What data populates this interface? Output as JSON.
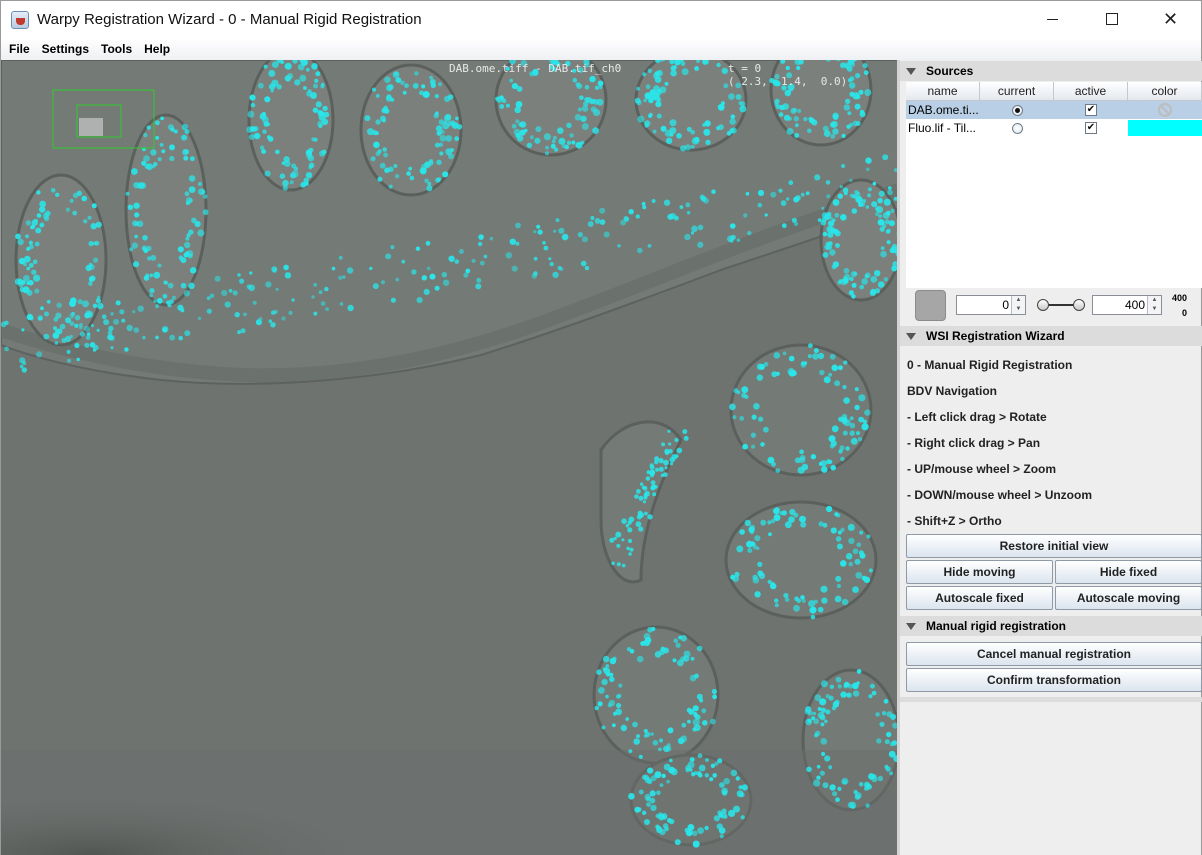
{
  "window": {
    "title": "Warpy Registration Wizard -  0 - Manual Rigid Registration",
    "minimize_icon": "minimize-icon",
    "maximize_icon": "maximize-icon",
    "close_glyph": "✕"
  },
  "menu": [
    "File",
    "Settings",
    "Tools",
    "Help"
  ],
  "viewer": {
    "source_label": "DAB.ome.tiff - DAB.tif_ch0",
    "timepoint": "t = 0",
    "coordinates": "( 2.3,  1.4,  0.0)"
  },
  "sources": {
    "header": "Sources",
    "columns": [
      "name",
      "current",
      "active",
      "color"
    ],
    "rows": [
      {
        "name": "DAB.ome.ti...",
        "current": true,
        "active": true,
        "color": "none",
        "selected": true
      },
      {
        "name": "Fluo.lif - Til...",
        "current": false,
        "active": true,
        "color": "#00ffff",
        "selected": false
      }
    ],
    "active_mark": "✔"
  },
  "display": {
    "min_value": "0",
    "max_value": "400",
    "range_max": "400",
    "range_min": "0"
  },
  "wizard": {
    "header": "WSI Registration Wizard",
    "lines": [
      "0 - Manual Rigid Registration",
      "BDV Navigation",
      "- Left click drag > Rotate",
      "- Right click drag > Pan",
      "- UP/mouse wheel > Zoom",
      "- DOWN/mouse wheel > Unzoom",
      "- Shift+Z > Ortho"
    ],
    "restore_button": "Restore initial view",
    "hide_moving_button": "Hide moving",
    "hide_fixed_button": "Hide fixed",
    "autoscale_fixed_button": "Autoscale fixed",
    "autoscale_moving_button": "Autoscale moving"
  },
  "manual": {
    "header": "Manual rigid registration",
    "cancel_button": "Cancel manual registration",
    "confirm_button": "Confirm transformation"
  },
  "colors": {
    "fluorescence": "#29e6ea",
    "tissue_background": "#6e7370",
    "selection": "#b8cfe5"
  }
}
